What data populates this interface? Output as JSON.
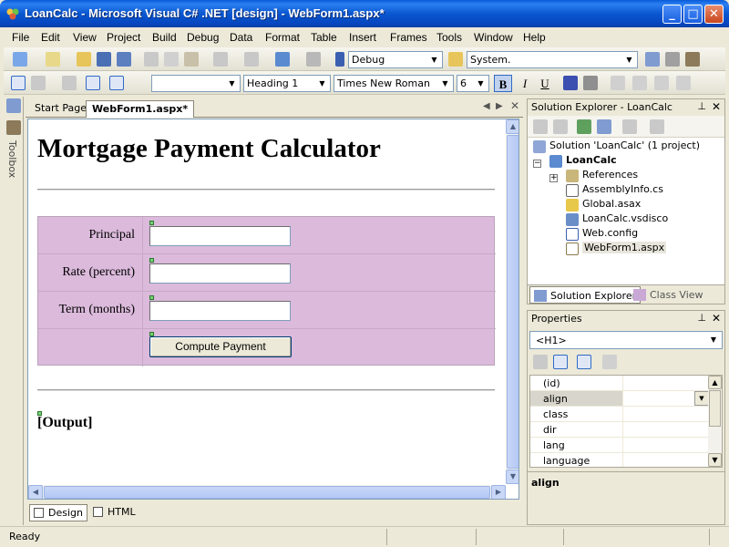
{
  "window": {
    "title": "LoanCalc - Microsoft Visual C# .NET [design] - WebForm1.aspx*",
    "min_label": "_",
    "max_label": "□",
    "close_label": "✕"
  },
  "menu": [
    "File",
    "Edit",
    "View",
    "Project",
    "Build",
    "Debug",
    "Data",
    "Format",
    "Table",
    "Insert",
    "Frames",
    "Tools",
    "Window",
    "Help"
  ],
  "toolbar": {
    "config": "Debug",
    "target": "System.",
    "style_block": "",
    "block_format": "Heading 1",
    "font_name": "Times New Roman",
    "font_size": "6",
    "bold_label": "B",
    "italic_label": "I",
    "underline_label": "U"
  },
  "toolbox": {
    "label": "Toolbox"
  },
  "doc_tabs": [
    {
      "label": "Start Page",
      "active": false
    },
    {
      "label": "WebForm1.aspx*",
      "active": true
    }
  ],
  "page": {
    "heading": "Mortgage Payment Calculator",
    "rows": [
      {
        "label": "Principal",
        "value": ""
      },
      {
        "label": "Rate (percent)",
        "value": ""
      },
      {
        "label": "Term (months)",
        "value": ""
      }
    ],
    "compute_button": "Compute Payment",
    "output_label": "[Output]"
  },
  "view_tabs": [
    {
      "label": "Design",
      "active": true
    },
    {
      "label": "HTML",
      "active": false
    }
  ],
  "solution_explorer": {
    "title": "Solution Explorer - LoanCalc",
    "items": [
      {
        "label": "Solution 'LoanCalc' (1 project)",
        "icon": "solution-icon",
        "bold": false
      },
      {
        "label": "LoanCalc",
        "icon": "csharp-project-icon",
        "bold": true
      },
      {
        "label": "References",
        "icon": "references-icon",
        "bold": false
      },
      {
        "label": "AssemblyInfo.cs",
        "icon": "cs-file-icon",
        "bold": false
      },
      {
        "label": "Global.asax",
        "icon": "asax-file-icon",
        "bold": false
      },
      {
        "label": "LoanCalc.vsdisco",
        "icon": "vsdisco-file-icon",
        "bold": false
      },
      {
        "label": "Web.config",
        "icon": "config-file-icon",
        "bold": false
      },
      {
        "label": "WebForm1.aspx",
        "icon": "aspx-file-icon",
        "bold": false,
        "selected": true
      }
    ],
    "tabs": [
      {
        "label": "Solution Explorer",
        "active": true
      },
      {
        "label": "Class View",
        "active": false
      }
    ]
  },
  "properties": {
    "title": "Properties",
    "selected_object": "<H1>",
    "rows": [
      {
        "name": "(id)",
        "value": ""
      },
      {
        "name": "align",
        "value": "",
        "selected": true
      },
      {
        "name": "class",
        "value": ""
      },
      {
        "name": "dir",
        "value": ""
      },
      {
        "name": "lang",
        "value": ""
      },
      {
        "name": "language",
        "value": ""
      }
    ],
    "description_title": "align"
  },
  "status": {
    "text": "Ready"
  },
  "colors": {
    "title_bar": "#0a57d0",
    "table_bg": "#dbbadb",
    "scroll_thumb": "#c1d2ee"
  }
}
